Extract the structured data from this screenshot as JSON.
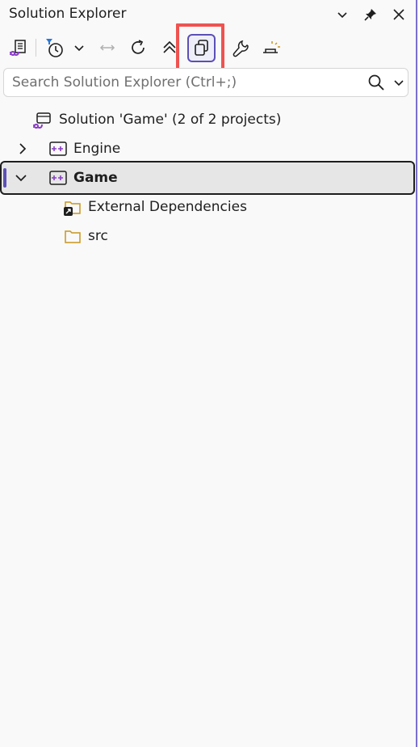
{
  "panel": {
    "title": "Solution Explorer"
  },
  "search": {
    "placeholder": "Search Solution Explorer (Ctrl+;)"
  },
  "tree": {
    "solution_label": "Solution 'Game' (2 of 2 projects)",
    "items": [
      {
        "label": "Engine"
      },
      {
        "label": "Game"
      },
      {
        "label": "External Dependencies"
      },
      {
        "label": "src"
      }
    ]
  },
  "colors": {
    "accent": "#5b4fb5",
    "highlight": "#ef5350",
    "folder": "#c8961e"
  }
}
